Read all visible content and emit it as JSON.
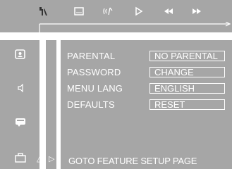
{
  "top_bar": {
    "icons": [
      "setup-tools-icon",
      "subtitle-icon",
      "audio-icon",
      "play-icon",
      "rewind-icon",
      "fast-forward-icon"
    ]
  },
  "side_icons": [
    "general-setup-icon",
    "speaker-icon",
    "video-icon",
    "preference-icon"
  ],
  "menu": {
    "rows": [
      {
        "label": "PARENTAL",
        "value": "NO PARENTAL"
      },
      {
        "label": "PASSWORD",
        "value": "CHANGE"
      },
      {
        "label": "MENU LANG",
        "value": "ENGLISH"
      },
      {
        "label": "DEFAULTS",
        "value": "RESET"
      }
    ]
  },
  "hint_text": "GOTO FEATURE SETUP PAGE",
  "colors": {
    "panel": "#a6a6a6",
    "background": "#ffffff",
    "text": "#ffffff"
  }
}
